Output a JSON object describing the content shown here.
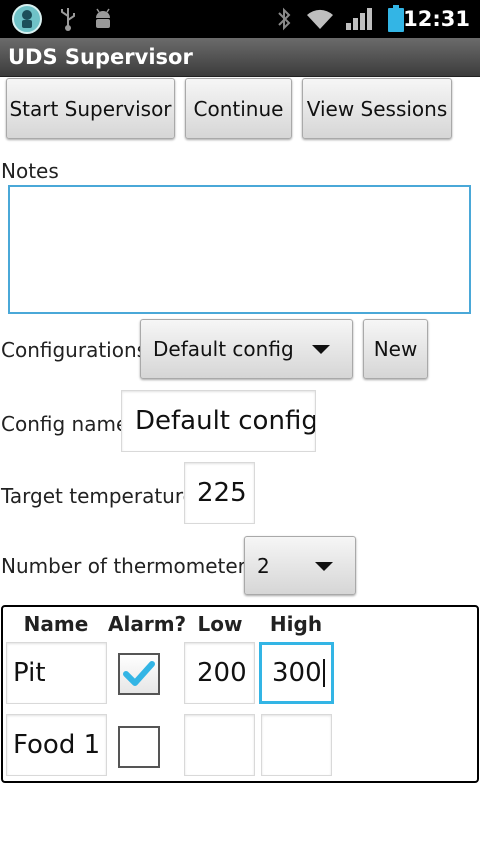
{
  "status_bar": {
    "time": "12:31",
    "icons": [
      "app-notification-icon",
      "usb-icon",
      "android-debug-icon",
      "bluetooth-icon",
      "wifi-icon",
      "signal-icon",
      "battery-icon"
    ]
  },
  "app": {
    "title": "UDS Supervisor"
  },
  "toolbar": {
    "start_label": "Start Supervisor",
    "continue_label": "Continue",
    "view_sessions_label": "View Sessions"
  },
  "notes": {
    "label": "Notes",
    "value": ""
  },
  "configurations": {
    "label": "Configurations",
    "selected": "Default config",
    "new_label": "New"
  },
  "config_name": {
    "label": "Config name",
    "value": "Default config"
  },
  "target_temperature": {
    "label": "Target temperature",
    "value": "225"
  },
  "thermometers": {
    "label": "Number of thermometers",
    "selected": "2",
    "headers": {
      "name": "Name",
      "alarm": "Alarm?",
      "low": "Low",
      "high": "High"
    },
    "rows": [
      {
        "name": "Pit",
        "alarm": true,
        "low": "200",
        "high": "300"
      },
      {
        "name": "Food 1",
        "alarm": false,
        "low": "",
        "high": ""
      }
    ]
  },
  "colors": {
    "focus_accent": "#33b5e5",
    "status_bar_bg": "#000000",
    "battery": "#33b5e5"
  }
}
